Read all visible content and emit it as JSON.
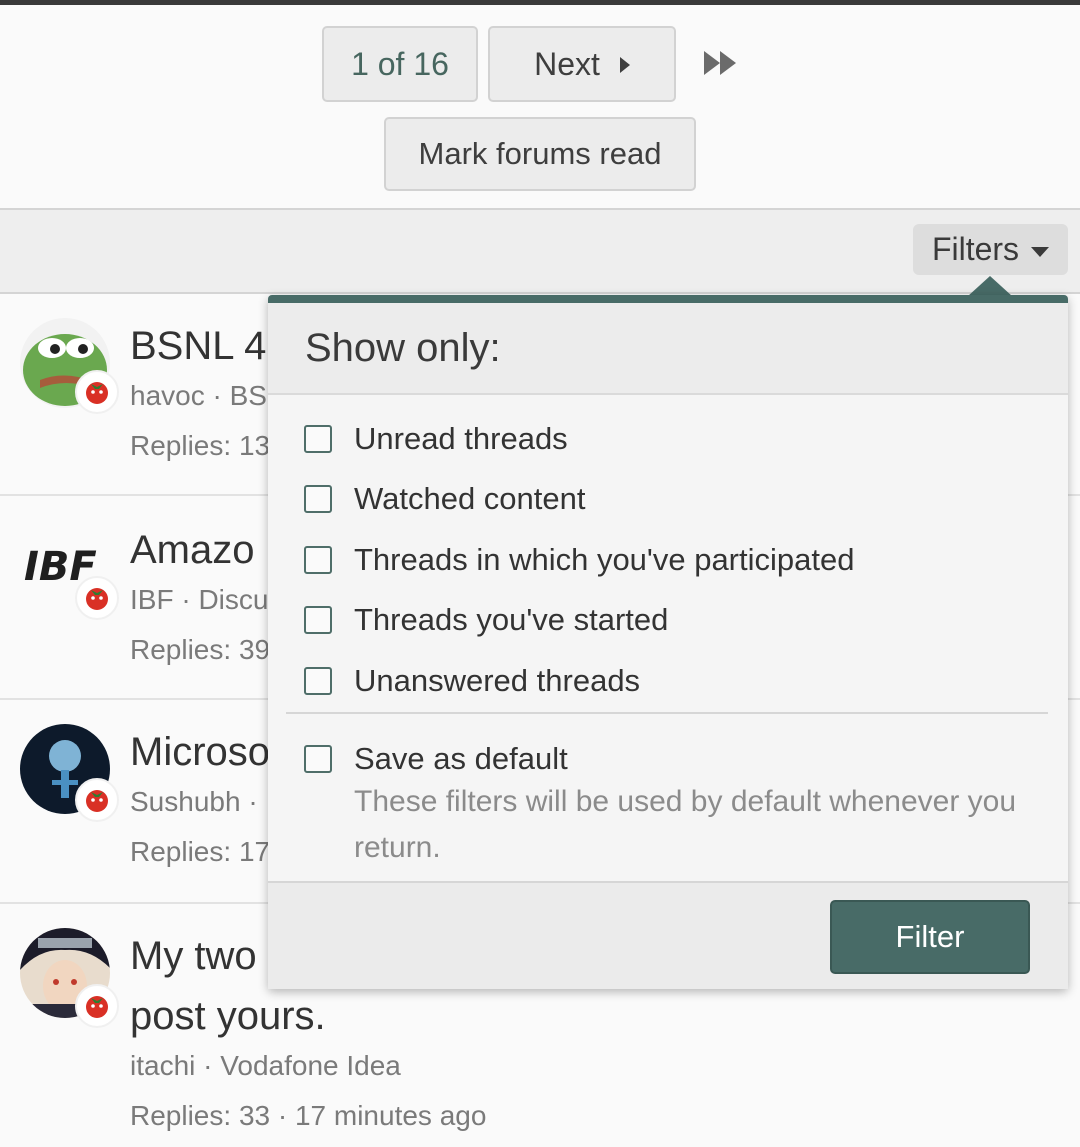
{
  "pagination": {
    "current": "1 of 16",
    "next_label": "Next"
  },
  "actions": {
    "mark_read": "Mark forums read"
  },
  "filter_bar": {
    "filters_label": "Filters"
  },
  "threads": [
    {
      "title": "BSNL 4",
      "meta": "havoc · BS",
      "stats": "Replies: 13"
    },
    {
      "title": "Amazo",
      "meta": "IBF · Discu",
      "stats": "Replies: 39",
      "avatar_text": "IBF"
    },
    {
      "title": "Microso",
      "meta": "Sushubh ·",
      "stats": "Replies: 17"
    },
    {
      "title": "My two",
      "title_line2": "post yours.",
      "meta": "itachi · Vodafone Idea",
      "stats": "Replies: 33 · 17 minutes ago"
    }
  ],
  "filter_menu": {
    "header": "Show only:",
    "options": [
      "Unread threads",
      "Watched content",
      "Threads in which you've participated",
      "Threads you've started",
      "Unanswered threads"
    ],
    "save_default": "Save as default",
    "save_hint": "These filters will be used by default whenever you return.",
    "submit_label": "Filter"
  },
  "colors": {
    "accent": "#486b67",
    "background": "#fafafa"
  }
}
